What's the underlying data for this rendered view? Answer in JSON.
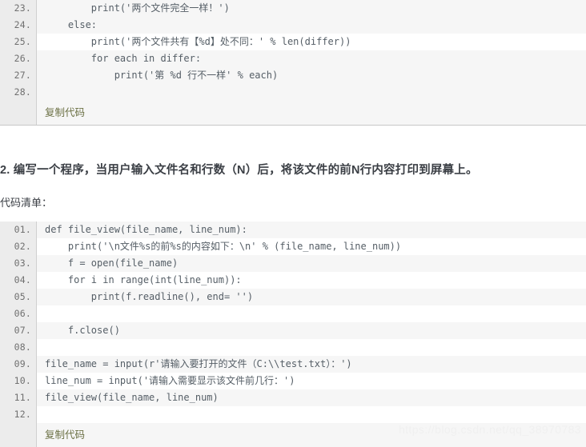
{
  "page": {
    "background_color": "#ffffff",
    "watermark": "https://blog.csdn.net/qq_38970783"
  },
  "code_block_1": {
    "copy_label": "复制代码",
    "lines": [
      {
        "num": "23.",
        "code": "        print('两个文件完全一样！')"
      },
      {
        "num": "24.",
        "code": "    else:"
      },
      {
        "num": "25.",
        "code": "        print('两个文件共有【%d】处不同：' % len(differ))"
      },
      {
        "num": "26.",
        "code": "        for each in differ:"
      },
      {
        "num": "27.",
        "code": "            print('第 %d 行不一样' % each)"
      },
      {
        "num": "28.",
        "code": ""
      }
    ]
  },
  "section_2": {
    "heading": "2. 编写一个程序，当用户输入文件名和行数（N）后，将该文件的前N行内容打印到屏幕上。",
    "subheading": "代码清单："
  },
  "code_block_2": {
    "copy_label": "复制代码",
    "lines": [
      {
        "num": "01.",
        "code": "def file_view(file_name, line_num):"
      },
      {
        "num": "02.",
        "code": "    print('\\n文件%s的前%s的内容如下：\\n' % (file_name, line_num))"
      },
      {
        "num": "03.",
        "code": "    f = open(file_name)"
      },
      {
        "num": "04.",
        "code": "    for i in range(int(line_num)):"
      },
      {
        "num": "05.",
        "code": "        print(f.readline(), end= '')"
      },
      {
        "num": "06.",
        "code": ""
      },
      {
        "num": "07.",
        "code": "    f.close()"
      },
      {
        "num": "08.",
        "code": ""
      },
      {
        "num": "09.",
        "code": "file_name = input(r'请输入要打开的文件（C:\\\\test.txt）：')"
      },
      {
        "num": "10.",
        "code": "line_num = input('请输入需要显示该文件前几行：')"
      },
      {
        "num": "11.",
        "code": "file_view(file_name, line_num)"
      },
      {
        "num": "12.",
        "code": ""
      }
    ]
  },
  "colors": {
    "code_bg": "#f6f6f6",
    "code_bg_alt": "#ffffff",
    "gutter_bg": "#ececec",
    "gutter_text": "#707070",
    "code_text": "#555e66",
    "copy_text": "#6b7044",
    "prose_text": "#3b3f45",
    "watermark_text": "#f0f0f0"
  }
}
